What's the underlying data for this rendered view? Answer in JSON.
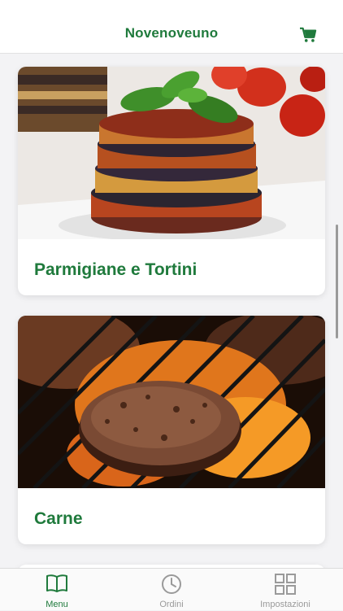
{
  "header": {
    "title": "Novenoveuno",
    "cart_icon": "shopping-cart-icon"
  },
  "categories": [
    {
      "label": "Parmigiane e Tortini",
      "image": "eggplant-parmigiana-photo"
    },
    {
      "label": "Carne",
      "image": "grilled-burger-patty-photo"
    }
  ],
  "tabbar": {
    "items": [
      {
        "label": "Menu",
        "icon": "book-icon",
        "active": true
      },
      {
        "label": "Ordini",
        "icon": "clock-icon",
        "active": false
      },
      {
        "label": "Impostazioni",
        "icon": "grid-icon",
        "active": false
      }
    ]
  },
  "colors": {
    "accent": "#1f7a3c",
    "inactive": "#9a9a9a",
    "background": "#f3f3f5"
  }
}
